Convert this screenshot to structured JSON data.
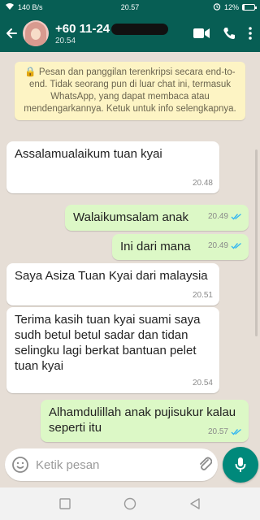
{
  "status_bar": {
    "speed": "140 B/s",
    "time": "20.57",
    "battery": "12%",
    "battery_level": 0.12
  },
  "header": {
    "contact_name": "+60 11-24",
    "contact_sub": "20.54"
  },
  "encryption_notice": "🔒 Pesan dan panggilan terenkripsi secara end-to-end. Tidak seorang pun di luar chat ini, termasuk WhatsApp, yang dapat membaca atau mendengarkannya. Ketuk untuk info selengkapnya.",
  "messages": [
    {
      "direction": "in",
      "text": "Assalamualaikum tuan kyai",
      "time": "20.48"
    },
    {
      "direction": "out",
      "text": "Walaikumsalam anak",
      "time": "20.49"
    },
    {
      "direction": "out",
      "text": "Ini dari mana",
      "time": "20.49"
    },
    {
      "direction": "in",
      "text": "Saya Asiza Tuan Kyai dari malaysia",
      "time": "20.51"
    },
    {
      "direction": "in",
      "text": "Terima kasih tuan kyai  suami saya sudh betul betul sadar dan tidan selingku lagi berkat bantuan pelet tuan kyai",
      "time": "20.54"
    },
    {
      "direction": "out",
      "text": "Alhamdulillah anak pujisukur kalau seperti itu",
      "time": "20.57"
    }
  ],
  "input": {
    "placeholder": "Ketik pesan"
  },
  "colors": {
    "header": "#075e54",
    "outgoing": "#dcf8c6",
    "incoming": "#ffffff",
    "accent": "#00897b",
    "read_ticks": "#34b7f1"
  },
  "icons": [
    "back-arrow-icon",
    "video-call-icon",
    "phone-icon",
    "more-vert-icon",
    "emoji-icon",
    "attach-icon",
    "camera-icon",
    "mic-icon"
  ]
}
